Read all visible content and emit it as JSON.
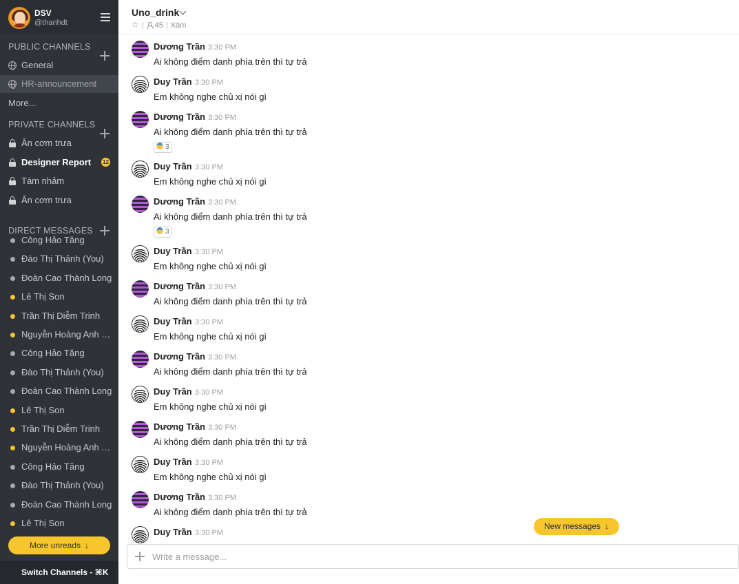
{
  "sidebar": {
    "team_name": "DSV",
    "username": "@thanhdt",
    "public_title": "PUBLIC CHANNELS",
    "public_channels": [
      {
        "label": "General",
        "active": false
      },
      {
        "label": "HR-announcement",
        "active": true
      }
    ],
    "more_label": "More...",
    "private_title": "PRIVATE CHANNELS",
    "private_channels": [
      {
        "label": "Ăn cơm trưa",
        "bold": false,
        "badge": ""
      },
      {
        "label": "Designer Report",
        "bold": true,
        "badge": "12"
      },
      {
        "label": "Tám nhảm",
        "bold": false,
        "badge": ""
      },
      {
        "label": "Ăn cơm trưa",
        "bold": false,
        "badge": ""
      }
    ],
    "direct_title": "DIRECT MESSAGES",
    "direct_messages": [
      {
        "label": "Công Hảo Tăng",
        "online": false
      },
      {
        "label": "Đào Thị Thảnh (You)",
        "online": false
      },
      {
        "label": "Đoàn Cao Thành Long",
        "online": false
      },
      {
        "label": "Lê Thị Son",
        "online": true
      },
      {
        "label": "Trần Thị Diễm Trinh",
        "online": true
      },
      {
        "label": "Nguyễn Hoàng Anh T...",
        "online": true
      },
      {
        "label": "Công Hảo Tăng",
        "online": false
      },
      {
        "label": "Đào Thị Thảnh (You)",
        "online": false
      },
      {
        "label": "Đoàn Cao Thành Long",
        "online": false
      },
      {
        "label": "Lê Thị Son",
        "online": true
      },
      {
        "label": "Trần Thị Diễm Trinh",
        "online": true
      },
      {
        "label": "Nguyễn Hoàng Anh T...",
        "online": true
      },
      {
        "label": "Công Hảo Tăng",
        "online": false
      },
      {
        "label": "Đào Thị Thảnh (You)",
        "online": false
      },
      {
        "label": "Đoàn Cao Thành Long",
        "online": false
      },
      {
        "label": "Lê Thị Son",
        "online": true
      }
    ],
    "more_unreads_label": "More unreads",
    "switch_channels_label": "Switch Channels - ⌘K"
  },
  "channel": {
    "name": "Uno_drink",
    "member_count": "45",
    "purpose": "Xàm"
  },
  "messages": [
    {
      "author": "Dương Trần",
      "time": "3:30 PM",
      "text": "Ai không điểm danh phía trên thì tự trả",
      "avatar": "stripe",
      "reaction": ""
    },
    {
      "author": "Duy Trần",
      "time": "3:30 PM",
      "text": "Em không nghe chủ xị nói gì",
      "avatar": "wave",
      "reaction": ""
    },
    {
      "author": "Dương Trần",
      "time": "3:30 PM",
      "text": "Ai không điểm danh phía trên thì tự trả",
      "avatar": "stripe",
      "reaction": "3"
    },
    {
      "author": "Duy Trần",
      "time": "3:30 PM",
      "text": "Em không nghe chủ xị nói gì",
      "avatar": "wave",
      "reaction": ""
    },
    {
      "author": "Dương Trần",
      "time": "3:30 PM",
      "text": "Ai không điểm danh phía trên thì tự trả",
      "avatar": "stripe",
      "reaction": "3"
    },
    {
      "author": "Duy Trần",
      "time": "3:30 PM",
      "text": "Em không nghe chủ xị nói gì",
      "avatar": "wave",
      "reaction": ""
    },
    {
      "author": "Dương Trần",
      "time": "3:30 PM",
      "text": "Ai không điểm danh phía trên thì tự trả",
      "avatar": "stripe",
      "reaction": ""
    },
    {
      "author": "Duy Trần",
      "time": "3:30 PM",
      "text": "Em không nghe chủ xị nói gì",
      "avatar": "wave",
      "reaction": ""
    },
    {
      "author": "Dương Trần",
      "time": "3:30 PM",
      "text": "Ai không điểm danh phía trên thì tự trả",
      "avatar": "stripe",
      "reaction": ""
    },
    {
      "author": "Duy Trần",
      "time": "3:30 PM",
      "text": "Em không nghe chủ xị nói gì",
      "avatar": "wave",
      "reaction": ""
    },
    {
      "author": "Dương Trần",
      "time": "3:30 PM",
      "text": "Ai không điểm danh phía trên thì tự trả",
      "avatar": "stripe",
      "reaction": ""
    },
    {
      "author": "Duy Trần",
      "time": "3:30 PM",
      "text": "Em không nghe chủ xị nói gì",
      "avatar": "wave",
      "reaction": ""
    },
    {
      "author": "Dương Trần",
      "time": "3:30 PM",
      "text": "Ai không điểm danh phía trên thì tự trả",
      "avatar": "stripe",
      "reaction": ""
    },
    {
      "author": "Duy Trần",
      "time": "3:30 PM",
      "text": "",
      "avatar": "wave",
      "reaction": ""
    }
  ],
  "new_messages_label": "New messages",
  "composer": {
    "placeholder": "Write a message..."
  },
  "colors": {
    "sidebar_bg": "#2f3338",
    "accent": "#f7c52c",
    "active_item": "#41464c"
  }
}
